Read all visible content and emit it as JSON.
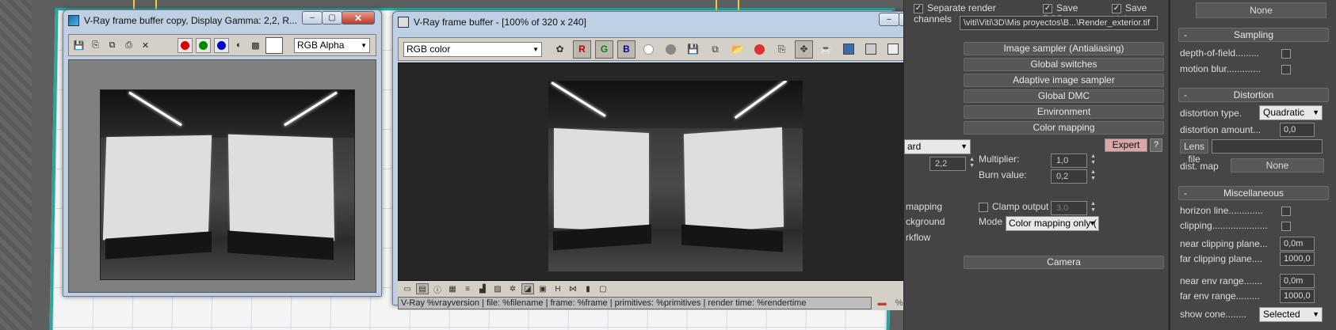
{
  "win1": {
    "title": "V-Ray frame buffer copy, Display Gamma: 2,2, R...",
    "channel": "RGB Alpha"
  },
  "win2": {
    "title": "V-Ray frame buffer - [100% of 320 x 240]",
    "channel": "RGB color",
    "btn_r": "R",
    "btn_g": "G",
    "btn_b": "B",
    "status": "V-Ray %vrayversion | file: %filename | frame: %frame | primitives: %primitives | render time: %rendertime"
  },
  "caption": {
    "min": "‒",
    "max": "▢",
    "close": "✕"
  },
  "render_setup": {
    "separate_render_channels": "Separate render channels",
    "save_rgb": "Save RGB",
    "save_alpha": "Save alpha",
    "path": "\\viti\\Viti\\3D\\Mis proyectos\\B...\\Render_exterior.tif",
    "rollouts": [
      "Image sampler (Antialiasing)",
      "Global switches",
      "Adaptive image sampler",
      "Global DMC",
      "Environment",
      "Color mapping"
    ],
    "camera_rollout": "Camera",
    "type_value": "ard",
    "gamma_value": "2,2",
    "expert": "Expert",
    "help": "?",
    "multiplier_label": "Multiplier:",
    "multiplier_value": "1,0",
    "burn_label": "Burn value:",
    "burn_value": "0,2",
    "sub_mapping": "mapping",
    "clamp_output": "Clamp output",
    "clamp_value": "3,0",
    "background": "ckground",
    "mode_label": "Mode",
    "mode_value": "Color mapping only (",
    "workflow": "rkflow"
  },
  "camera_panel": {
    "none_top": "None",
    "sampling": "Sampling",
    "depth_of_field": "depth-of-field.........",
    "motion_blur": "motion blur.............",
    "distortion": "Distortion",
    "distortion_type_label": "distortion type.",
    "distortion_type_value": "Quadratic",
    "distortion_amount_label": "distortion amount...",
    "distortion_amount_value": "0,0",
    "lens_file": "Lens file",
    "dist_map": "dist. map",
    "dist_map_value": "None",
    "miscellaneous": "Miscellaneous",
    "horizon_line": "horizon line.............",
    "clipping": "clipping.....................",
    "near_clipping_label": "near clipping plane...",
    "near_clipping_value": "0,0m",
    "far_clipping_label": "far clipping plane....",
    "far_clipping_value": "1000,0",
    "near_env_label": "near env range.......",
    "near_env_value": "0,0m",
    "far_env_label": "far env range.........",
    "far_env_value": "1000,0",
    "show_cone_label": "show cone........",
    "show_cone_value": "Selected"
  }
}
